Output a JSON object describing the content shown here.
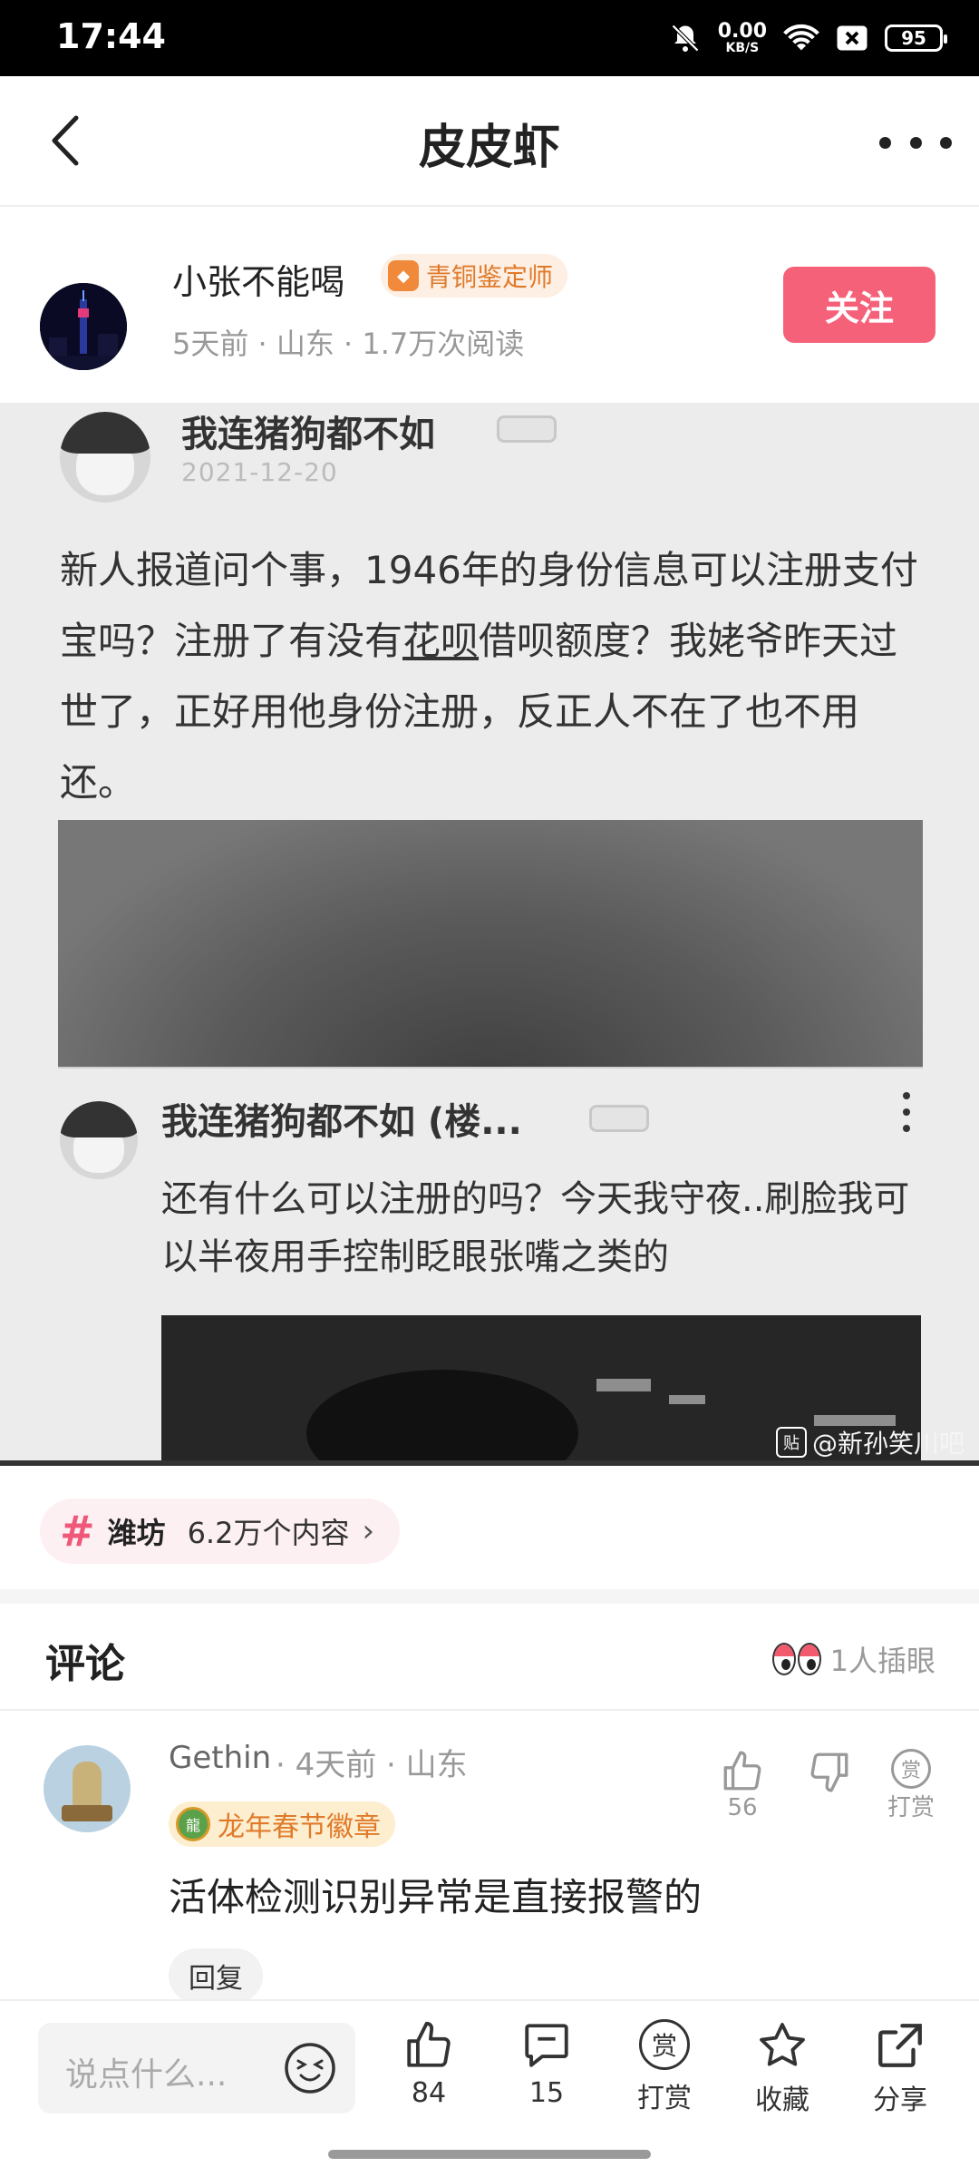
{
  "status_bar": {
    "time": "17:44",
    "net_speed": "0.00",
    "net_unit": "KB/S",
    "battery": "95",
    "icons": [
      "bell-off-icon",
      "wifi-icon",
      "sim-off-icon",
      "battery-icon"
    ]
  },
  "header": {
    "title": "皮皮虾",
    "back_icon": "chevron-left-icon",
    "more_icon": "more-dots-icon"
  },
  "author": {
    "name": "小张不能喝",
    "badge": "青铜鉴定师",
    "meta": "5天前 · 山东 · 1.7万次阅读",
    "follow_label": "关注"
  },
  "post_image": {
    "poster_name": "我连猪狗都不如",
    "post_date": "2021-12-20",
    "post_text_before": "新人报道问个事，1946年的身份信息可以注册支付宝吗？注册了有没有",
    "post_text_link": "花呗",
    "post_text_after": "借呗额度？我姥爷昨天过世了，正好用他身份注册，反正人不在了也不用还。",
    "reply_name": "我连猪狗都不如 (楼...",
    "reply_text": "还有什么可以注册的吗？今天我守夜..刷脸我可以半夜用手控制眨眼张嘴之类的",
    "watermark": "@新孙笑川吧",
    "watermark_icon": "贴"
  },
  "topic": {
    "hash_icon": "#",
    "name": "潍坊",
    "count": "6.2万个内容",
    "chevron": "›"
  },
  "comments": {
    "title": "评论",
    "poke_text": "1人插眼",
    "items": [
      {
        "user": "Gethin",
        "meta": "· 4天前 · 山东",
        "badge": "龙年春节徽章",
        "text": "活体检测识别异常是直接报警的",
        "likes": "56",
        "reward_icon": "赏",
        "reward_label": "打赏",
        "reply_label": "回复"
      }
    ]
  },
  "bottom_bar": {
    "input_placeholder": "说点什么...",
    "like_count": "84",
    "comment_count": "15",
    "reward_icon": "赏",
    "reward_label": "打赏",
    "fav_label": "收藏",
    "share_label": "分享"
  },
  "colors": {
    "accent_pink": "#f6617a",
    "badge_orange": "#e07a2a",
    "status_bar": "#000000"
  }
}
